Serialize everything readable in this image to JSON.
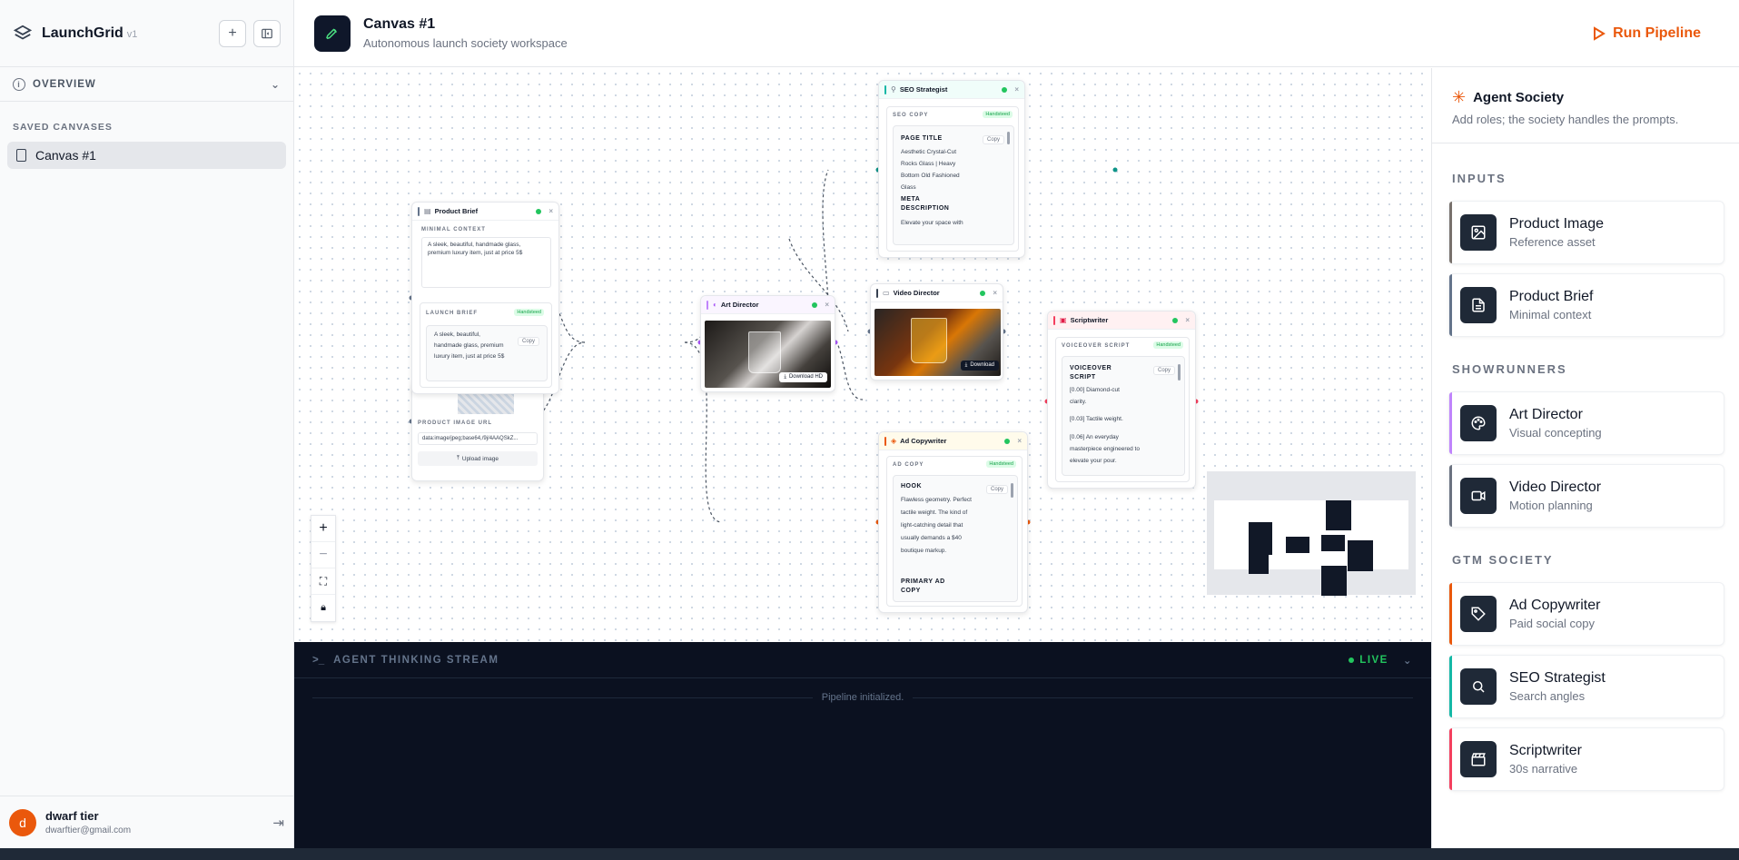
{
  "sidebar": {
    "brand": "LaunchGrid",
    "version": "v1",
    "overview_label": "OVERVIEW",
    "saved_heading": "SAVED CANVASES",
    "canvases": [
      "Canvas #1"
    ],
    "user": {
      "initial": "d",
      "name": "dwarf tier",
      "email": "dwarftier@gmail.com"
    }
  },
  "header": {
    "title": "Canvas #1",
    "subtitle": "Autonomous launch society workspace",
    "run_label": "Run Pipeline"
  },
  "nodes": {
    "product_brief": {
      "title": "Product Brief",
      "context_label": "MINIMAL CONTEXT",
      "context_text": "A sleek, beautiful, handmade glass, premium luxury item, just at price 5$",
      "launch_label": "LAUNCH BRIEF",
      "badge": "Handsteed",
      "launch_text": "A sleek, beautiful, handmade glass, premium luxury item, just at price 5$",
      "copy": "Copy"
    },
    "product_image": {
      "url_label": "PRODUCT IMAGE URL",
      "url_value": "data:image/jpeg;base64,/9j/4AAQSkZ...",
      "upload_label": "Upload image"
    },
    "art_director": {
      "title": "Art Director",
      "download": "Download HD"
    },
    "video_director": {
      "title": "Video Director",
      "download": "Download"
    },
    "seo": {
      "title": "SEO Strategist",
      "label": "SEO COPY",
      "badge": "Handsteed",
      "copy": "Copy",
      "page_title_head": "PAGE TITLE",
      "page_title_text": "Aesthetic Crystal-Cut Rocks Glass | Heavy Bottom Old Fashioned Glass",
      "meta_head": "META DESCRIPTION",
      "meta_text": "Elevate your space with"
    },
    "scriptwriter": {
      "title": "Scriptwriter",
      "label": "VOICEOVER SCRIPT",
      "badge": "Handsteed",
      "copy": "Copy",
      "head": "VOICEOVER SCRIPT",
      "lines": [
        "[0.00] Diamond-cut clarity.",
        "[0.03] Tactile weight.",
        "[0.06] An everyday masterpiece engineered to elevate your pour."
      ]
    },
    "ad_copywriter": {
      "title": "Ad Copywriter",
      "label": "AD COPY",
      "badge": "Handsteed",
      "copy": "Copy",
      "hook_head": "HOOK",
      "hook_text": "Flawless geometry. Perfect tactile weight. The kind of light-catching detail that usually demands a $40 boutique markup.",
      "primary_head": "PRIMARY AD COPY"
    }
  },
  "stream": {
    "title": "AGENT THINKING STREAM",
    "live": "LIVE",
    "message": "Pipeline initialized."
  },
  "panel": {
    "title": "Agent Society",
    "subtitle": "Add roles; the society handles the prompts.",
    "sections": [
      {
        "name": "INPUTS",
        "items": [
          {
            "title": "Product Image",
            "sub": "Reference asset",
            "color": "#78716c",
            "icon": "image-icon"
          },
          {
            "title": "Product Brief",
            "sub": "Minimal context",
            "color": "#64748b",
            "icon": "document-icon"
          }
        ]
      },
      {
        "name": "SHOWRUNNERS",
        "items": [
          {
            "title": "Art Director",
            "sub": "Visual concepting",
            "color": "#c084fc",
            "icon": "palette-icon"
          },
          {
            "title": "Video Director",
            "sub": "Motion planning",
            "color": "#6b7280",
            "icon": "video-icon"
          }
        ]
      },
      {
        "name": "GTM SOCIETY",
        "items": [
          {
            "title": "Ad Copywriter",
            "sub": "Paid social copy",
            "color": "#ea580c",
            "icon": "tag-icon"
          },
          {
            "title": "SEO Strategist",
            "sub": "Search angles",
            "color": "#14b8a6",
            "icon": "search-icon"
          },
          {
            "title": "Scriptwriter",
            "sub": "30s narrative",
            "color": "#f43f5e",
            "icon": "clapper-icon"
          }
        ]
      }
    ]
  },
  "colors": {
    "accent": "#ea580c",
    "dark": "#0f172a",
    "live": "#22c55e"
  }
}
